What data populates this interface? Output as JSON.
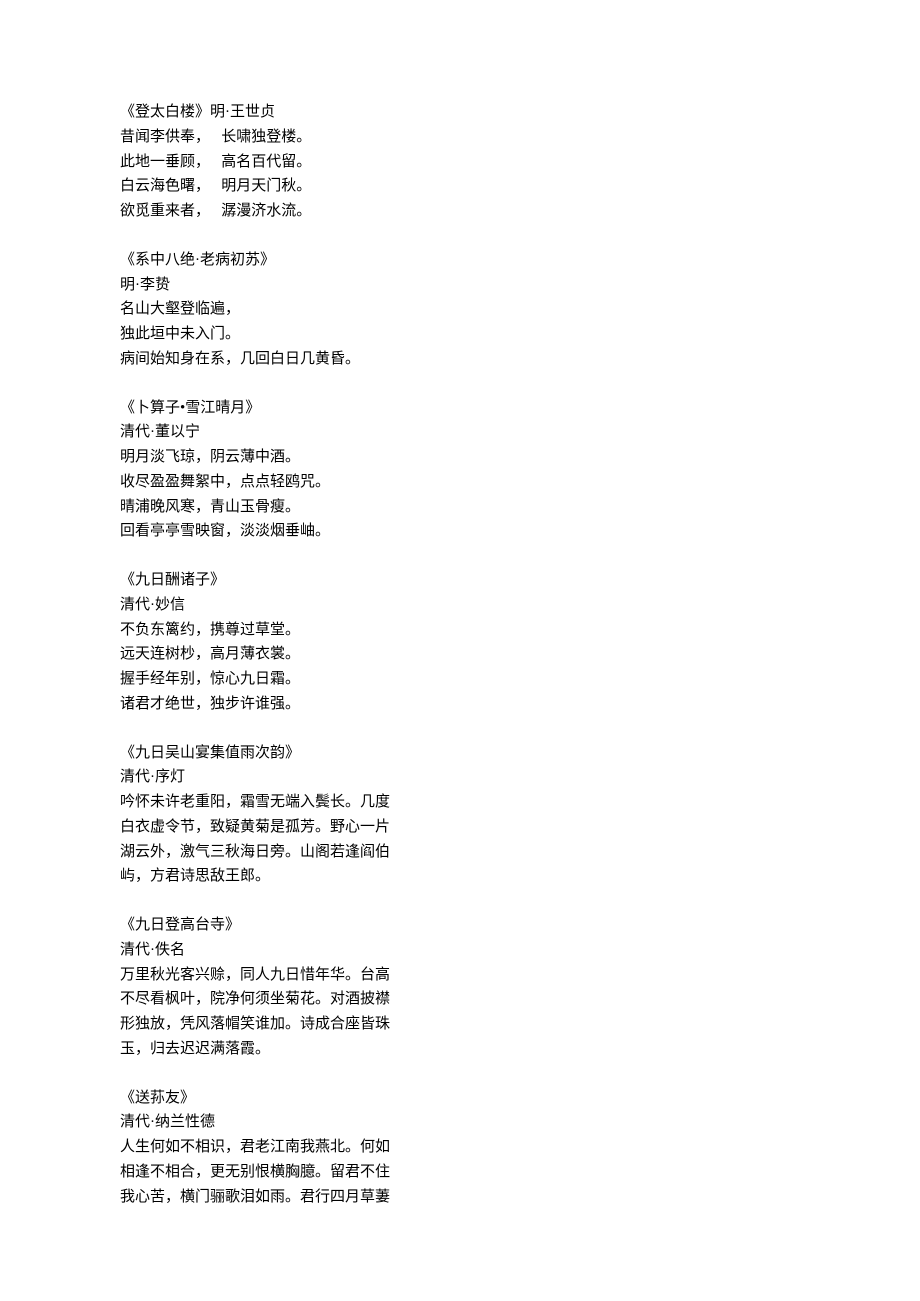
{
  "poems": [
    {
      "lines": [
        "《登太白楼》明·王世贞",
        "昔闻李供奉，   长啸独登楼。",
        "此地一垂顾，   高名百代留。",
        "白云海色曙，   明月天门秋。",
        "欲觅重来者，   潺漫济水流。"
      ]
    },
    {
      "lines": [
        "《系中八绝·老病初苏》",
        "明·李贽",
        "名山大壑登临遍，",
        "独此垣中未入门。",
        "病间始知身在系，几回白日几黄昏。"
      ]
    },
    {
      "lines": [
        "《卜算子•雪江晴月》",
        "清代·董以宁",
        "明月淡飞琼，阴云薄中酒。",
        "收尽盈盈舞絮中，点点轻鸥咒。",
        "晴浦晚风寒，青山玉骨瘦。",
        "回看亭亭雪映窗，淡淡烟垂岫。"
      ]
    },
    {
      "lines": [
        "《九日酬诸子》",
        "清代·妙信",
        "不负东篱约，携尊过草堂。",
        "远天连树杪，高月薄衣裳。",
        "握手经年别，惊心九日霜。",
        "诸君才绝世，独步许谁强。"
      ]
    },
    {
      "lines": [
        "《九日吴山宴集值雨次韵》",
        "清代·序灯",
        "吟怀未许老重阳，霜雪无端入鬓长。几度",
        "白衣虚令节，致疑黄菊是孤芳。野心一片",
        "湖云外，激气三秋海日旁。山阁若逢阎伯",
        "屿，方君诗思敌王郎。"
      ]
    },
    {
      "lines": [
        "《九日登高台寺》",
        "清代·佚名",
        "万里秋光客兴赊，同人九日惜年华。台高",
        "不尽看枫叶，院净何须坐菊花。对酒披襟",
        "形独放，凭风落帽笑谁加。诗成合座皆珠",
        "玉，归去迟迟满落霞。"
      ]
    },
    {
      "lines": [
        "《送荪友》",
        "清代·纳兰性德",
        "人生何如不相识，君老江南我燕北。何如",
        "相逢不相合，更无别恨横胸臆。留君不住",
        "我心苦，横门骊歌泪如雨。君行四月草萋"
      ]
    }
  ]
}
